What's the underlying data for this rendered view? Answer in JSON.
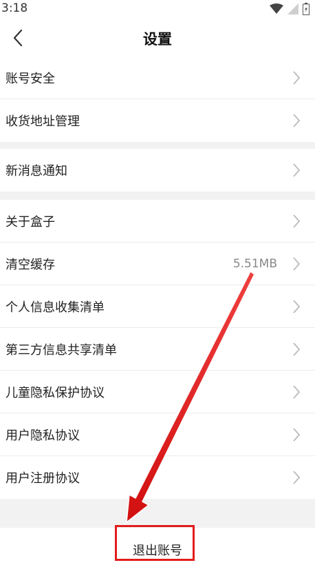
{
  "status_bar": {
    "time": "3:18",
    "icons": [
      "wifi-icon",
      "signal-icon",
      "battery-icon"
    ]
  },
  "nav": {
    "title": "设置",
    "back_icon": "chevron-left-icon"
  },
  "groups": [
    {
      "items": [
        {
          "label": "账号安全"
        },
        {
          "label": "收货地址管理"
        }
      ]
    },
    {
      "items": [
        {
          "label": "新消息通知"
        }
      ]
    },
    {
      "items": [
        {
          "label": "关于盒子"
        },
        {
          "label": "清空缓存",
          "value": "5.51MB"
        },
        {
          "label": "个人信息收集清单"
        },
        {
          "label": "第三方信息共享清单"
        },
        {
          "label": "儿童隐私保护协议"
        },
        {
          "label": "用户隐私协议"
        },
        {
          "label": "用户注册协议"
        }
      ]
    }
  ],
  "logout": {
    "label": "退出账号"
  },
  "colors": {
    "annotation_red": "#e31b1b",
    "background": "#f2f2f2",
    "chevron": "#bbbbbb"
  }
}
